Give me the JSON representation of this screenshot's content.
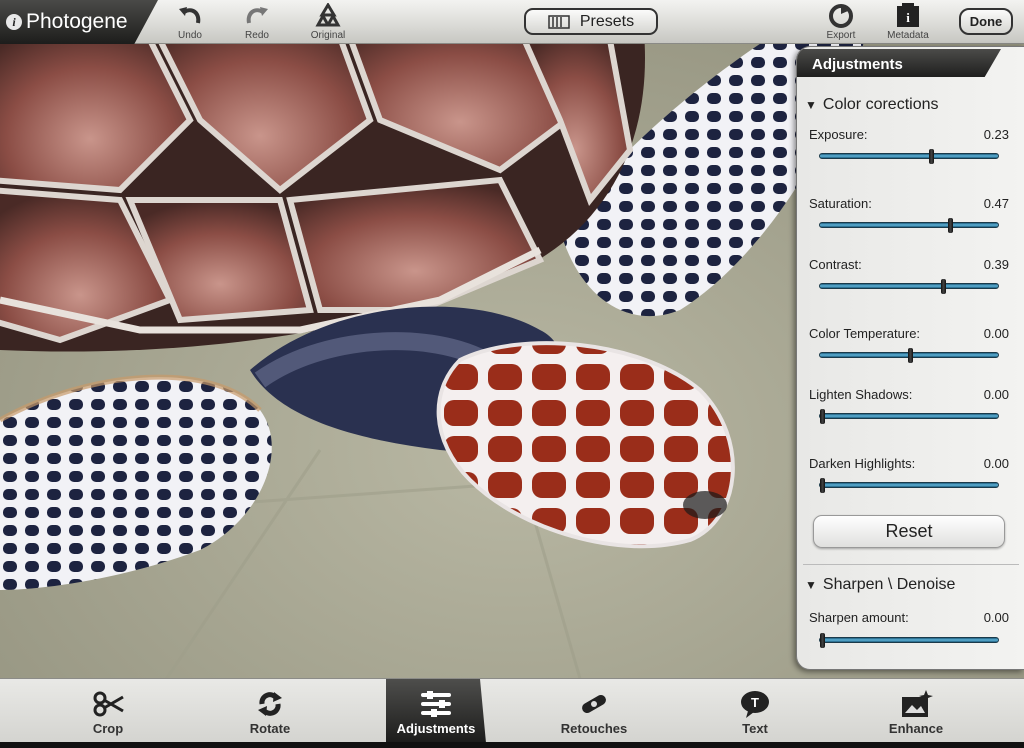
{
  "app": {
    "title": "Photogene"
  },
  "toolbar": {
    "undo_label": "Undo",
    "redo_label": "Redo",
    "original_label": "Original",
    "presets_label": "Presets",
    "export_label": "Export",
    "metadata_label": "Metadata",
    "done_label": "Done"
  },
  "panel": {
    "title": "Adjustments",
    "color_section": "Color corections",
    "sliders": [
      {
        "label": "Exposure:",
        "value": "0.23",
        "level": 0.62
      },
      {
        "label": "Saturation:",
        "value": "0.47",
        "level": 0.73
      },
      {
        "label": "Contrast:",
        "value": "0.39",
        "level": 0.69
      },
      {
        "label": "Color Temperature:",
        "value": "0.00",
        "level": 0.5
      },
      {
        "label": "Lighten Shadows:",
        "value": "0.00",
        "level": 0.0
      },
      {
        "label": "Darken Highlights:",
        "value": "0.00",
        "level": 0.0
      }
    ],
    "reset_label": "Reset",
    "sharpen_section": "Sharpen \\ Denoise",
    "sharpen": {
      "label": "Sharpen amount:",
      "value": "0.00",
      "level": 0.0
    }
  },
  "bottom_tabs": [
    {
      "label": "Crop",
      "icon": "scissors-icon"
    },
    {
      "label": "Rotate",
      "icon": "rotate-icon"
    },
    {
      "label": "Adjustments",
      "icon": "sliders-icon",
      "active": true
    },
    {
      "label": "Retouches",
      "icon": "bandage-icon"
    },
    {
      "label": "Text",
      "icon": "text-bubble-icon"
    },
    {
      "label": "Enhance",
      "icon": "enhance-icon"
    }
  ],
  "colors": {
    "slider_track": "#3d8fb8",
    "toolbar_bg": "#dcdcd8",
    "active_tab": "#2a2a29"
  }
}
